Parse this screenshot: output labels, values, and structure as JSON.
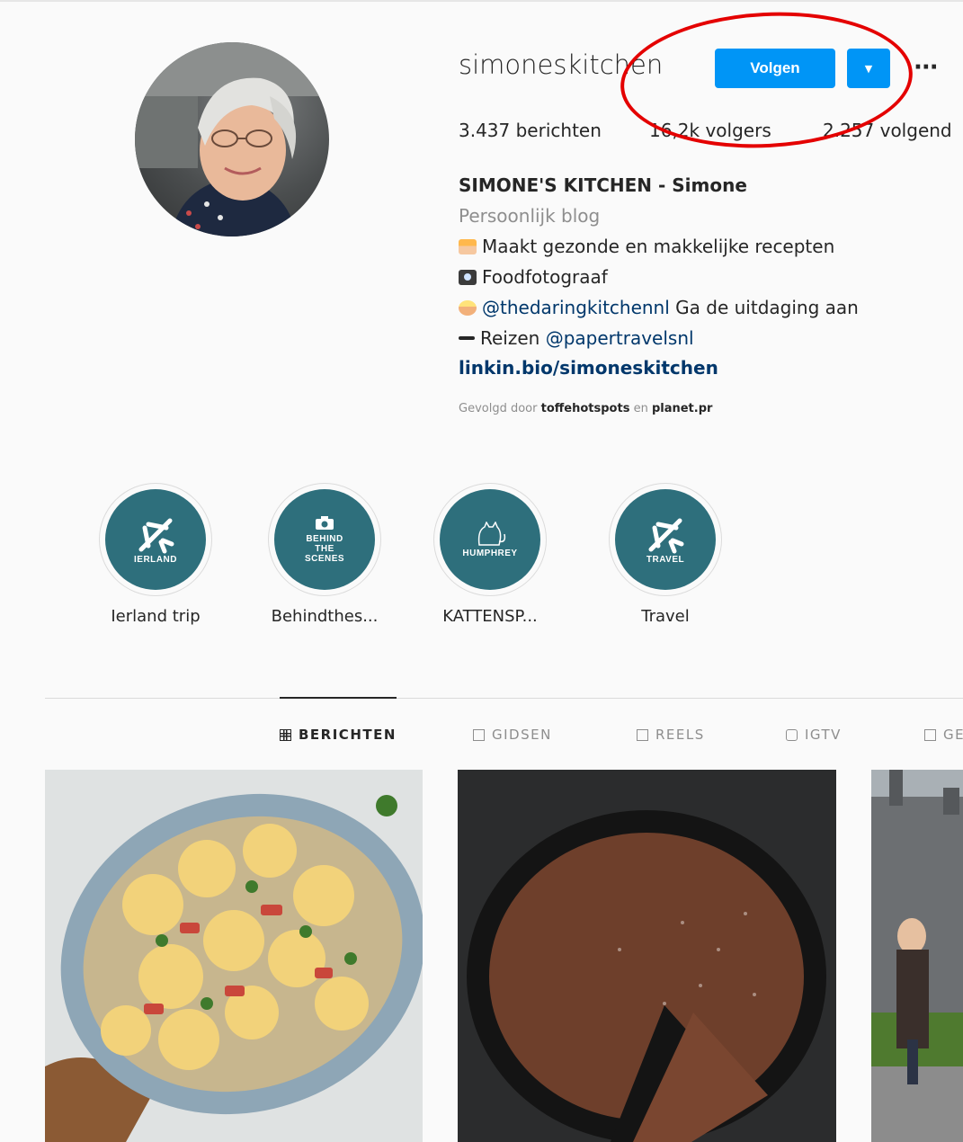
{
  "profile": {
    "username": "simoneskitchen",
    "follow_label": "Volgen",
    "dropdown_icon": "chevron-down-icon",
    "more_icon": "more-options-icon"
  },
  "stats": {
    "posts": "3.437 berichten",
    "followers": "16,2k volgers",
    "following": "2.257 volgend"
  },
  "bio": {
    "name": "SIMONE'S KITCHEN - Simone",
    "category": "Persoonlijk blog",
    "line1": "Maakt gezonde en makkelijke recepten",
    "line2": "Foodfotograaf",
    "line3_mention": "@thedaringkitchennl",
    "line3_text": " Ga de uitdaging aan",
    "line4_text": "Reizen ",
    "line4_mention": "@papertravelsnl",
    "link": "linkin.bio/simoneskitchen"
  },
  "followed_by": {
    "prefix": "Gevolgd door ",
    "user1": "toffehotspots",
    "conj": " en ",
    "user2": "planet.pr"
  },
  "highlights": [
    {
      "label": "Ierland trip",
      "badge": "IERLAND",
      "icon": "airplane-icon"
    },
    {
      "label": "Behindthes...",
      "badge": "BEHIND\nTHE\nSCENES",
      "icon": "camera-icon"
    },
    {
      "label": "KATTENSP...",
      "badge": "HUMPHREY",
      "icon": "cat-icon"
    },
    {
      "label": "Travel",
      "badge": "TRAVEL",
      "icon": "airplane-icon"
    }
  ],
  "tabs": [
    {
      "label": "BERICHTEN",
      "icon": "grid-icon",
      "active": true
    },
    {
      "label": "GIDSEN",
      "icon": "guides-icon",
      "active": false
    },
    {
      "label": "REELS",
      "icon": "reels-icon",
      "active": false
    },
    {
      "label": "IGTV",
      "icon": "igtv-icon",
      "active": false
    },
    {
      "label": "GE",
      "icon": "tagged-icon",
      "active": false
    }
  ],
  "colors": {
    "accent": "#0095f6",
    "link": "#00376b",
    "highlight_bg": "#2e6f7c",
    "annotation": "#e40000"
  }
}
